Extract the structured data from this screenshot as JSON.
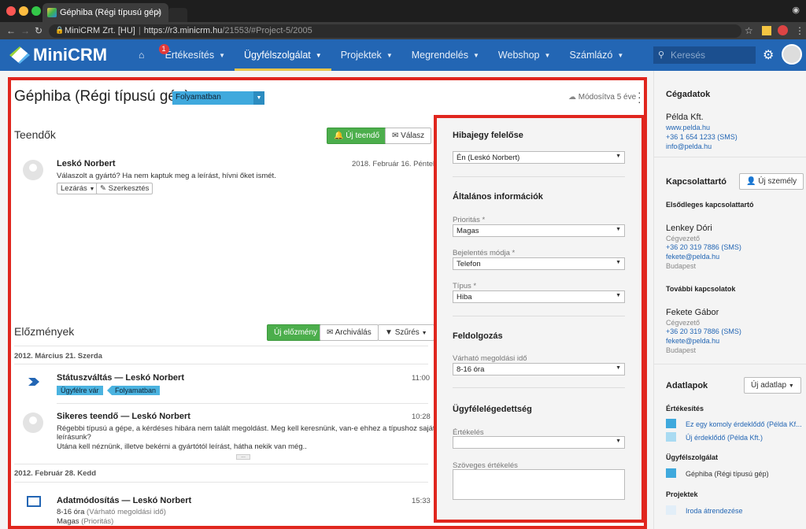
{
  "browser": {
    "tab_title": "Géphiba (Régi típusú gép)",
    "tab_close": "✕",
    "site_name": "MiniCRM Zrt. [HU]",
    "url_host": "https://r3.minicrm.hu",
    "url_path": "/21553/#Project-5/2005"
  },
  "header": {
    "logo": "MiniCRM",
    "nav": [
      {
        "label": "Értékesítés",
        "badge": "1"
      },
      {
        "label": "Ügyfélszolgálat"
      },
      {
        "label": "Projektek"
      },
      {
        "label": "Megrendelés"
      },
      {
        "label": "Webshop"
      },
      {
        "label": "Számlázó"
      }
    ],
    "search_placeholder": "Keresés"
  },
  "page": {
    "title": "Géphiba (Régi típusú gép)",
    "status": "Folyamatban",
    "modified": "Módosítva 5 éve"
  },
  "tasks": {
    "title": "Teendők",
    "new_btn": "Új teendő",
    "reply_btn": "Válasz",
    "item": {
      "author": "Leskó Norbert",
      "date": "2018. Február 16. Péntek",
      "text": "Válaszolt a gyártó? Ha nem kaptuk meg a leírást, hívni őket ismét.",
      "close_btn": "Lezárás",
      "edit_btn": "Szerkesztés"
    }
  },
  "history": {
    "title": "Előzmények",
    "new_btn": "Új előzmény",
    "archive_btn": "Archiválás",
    "filter_btn": "Szűrés",
    "day1": "2012. Március 21. Szerda",
    "e1": {
      "title": "Státuszváltás — Leskó Norbert",
      "time": "11:00",
      "from": "Ügyfélre vár",
      "to": "Folyamatban"
    },
    "e2": {
      "title": "Sikeres teendő — Leskó Norbert",
      "time": "10:28",
      "line1": "Régebbi típusú a gépe, a kérdéses hibára nem talált megoldást. Meg kell keresnünk, van-e ehhez a típushoz saját",
      "line2": "leírásunk?",
      "line3": "Utána kell néznünk, illetve bekérni a gyártótól leírást, hátha nekik van még..",
      "more": "..."
    },
    "day2": "2012. Február 28. Kedd",
    "e3": {
      "title": "Adatmódosítás — Leskó Norbert",
      "time": "15:33",
      "line1": "8-16 óra",
      "line1b": "(Várható megoldási idő)",
      "line2": "Magas",
      "line2b": "(Prioritás)"
    }
  },
  "panel": {
    "owner_h": "Hibajegy felelőse",
    "owner_val": "Én (Leskó Norbert)",
    "general_h": "Általános információk",
    "priority_l": "Prioritás *",
    "priority_v": "Magas",
    "report_l": "Bejelentés módja *",
    "report_v": "Telefon",
    "type_l": "Típus *",
    "type_v": "Hiba",
    "proc_h": "Feldolgozás",
    "eta_l": "Várható megoldási idő",
    "eta_v": "8-16 óra",
    "sat_h": "Ügyfélelégedettség",
    "rating_l": "Értékelés",
    "text_rating_l": "Szöveges értékelés"
  },
  "sidebar": {
    "company_h": "Cégadatok",
    "company": "Példa Kft.",
    "web": "www.pelda.hu",
    "phone": "+36 1 654 1233 (SMS)",
    "email": "info@pelda.hu",
    "contacts_h": "Kapcsolattartó",
    "new_person": "Új személy",
    "primary_h": "Elsődleges kapcsolattartó",
    "c1": {
      "name": "Lenkey Dóri",
      "role": "Cégvezető",
      "phone": "+36 20 319 7886 (SMS)",
      "email": "fekete@pelda.hu",
      "city": "Budapest"
    },
    "more_h": "További kapcsolatok",
    "c2": {
      "name": "Fekete Gábor",
      "role": "Cégvezető",
      "phone": "+36 20 319 7886 (SMS)",
      "email": "fekete@pelda.hu",
      "city": "Budapest"
    },
    "datasheets_h": "Adatlapok",
    "new_sheet": "Új adatlap",
    "sales_h": "Értékesítés",
    "s1": "Ez egy komoly érdeklődő (Példa Kf...",
    "s2": "Új érdeklődő (Példa Kft.)",
    "support_h": "Ügyfélszolgálat",
    "sup1": "Géphiba (Régi típusú gép)",
    "projects_h": "Projektek",
    "p1": "Iroda átrendezése"
  }
}
